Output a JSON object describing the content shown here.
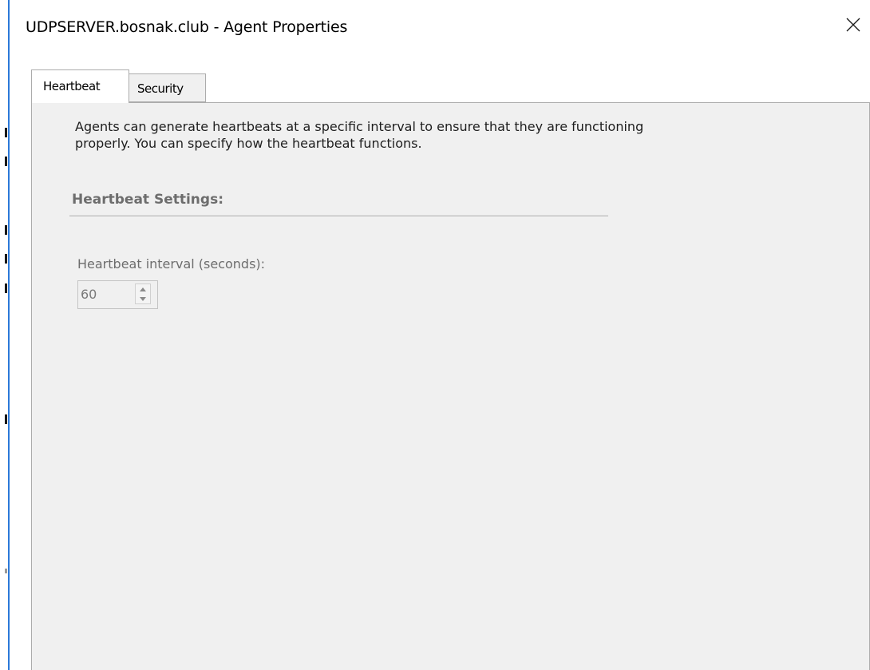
{
  "dialog": {
    "title": "UDPSERVER.bosnak.club - Agent Properties",
    "close_icon": "close-icon"
  },
  "tabs": [
    {
      "label": "Heartbeat",
      "selected": true
    },
    {
      "label": "Security",
      "selected": false
    }
  ],
  "heartbeat_tab": {
    "description": "Agents can generate heartbeats at a specific interval to ensure that they are functioning\nproperly.  You can specify how the heartbeat functions.",
    "section_heading": "Heartbeat Settings:",
    "interval_label": "Heartbeat interval (seconds):",
    "interval_value": "60",
    "interval_enabled": false
  },
  "colors": {
    "panel_bg": "#f0f0f0",
    "disabled_text": "#6d6d6d",
    "window_accent": "#2b79d8"
  }
}
